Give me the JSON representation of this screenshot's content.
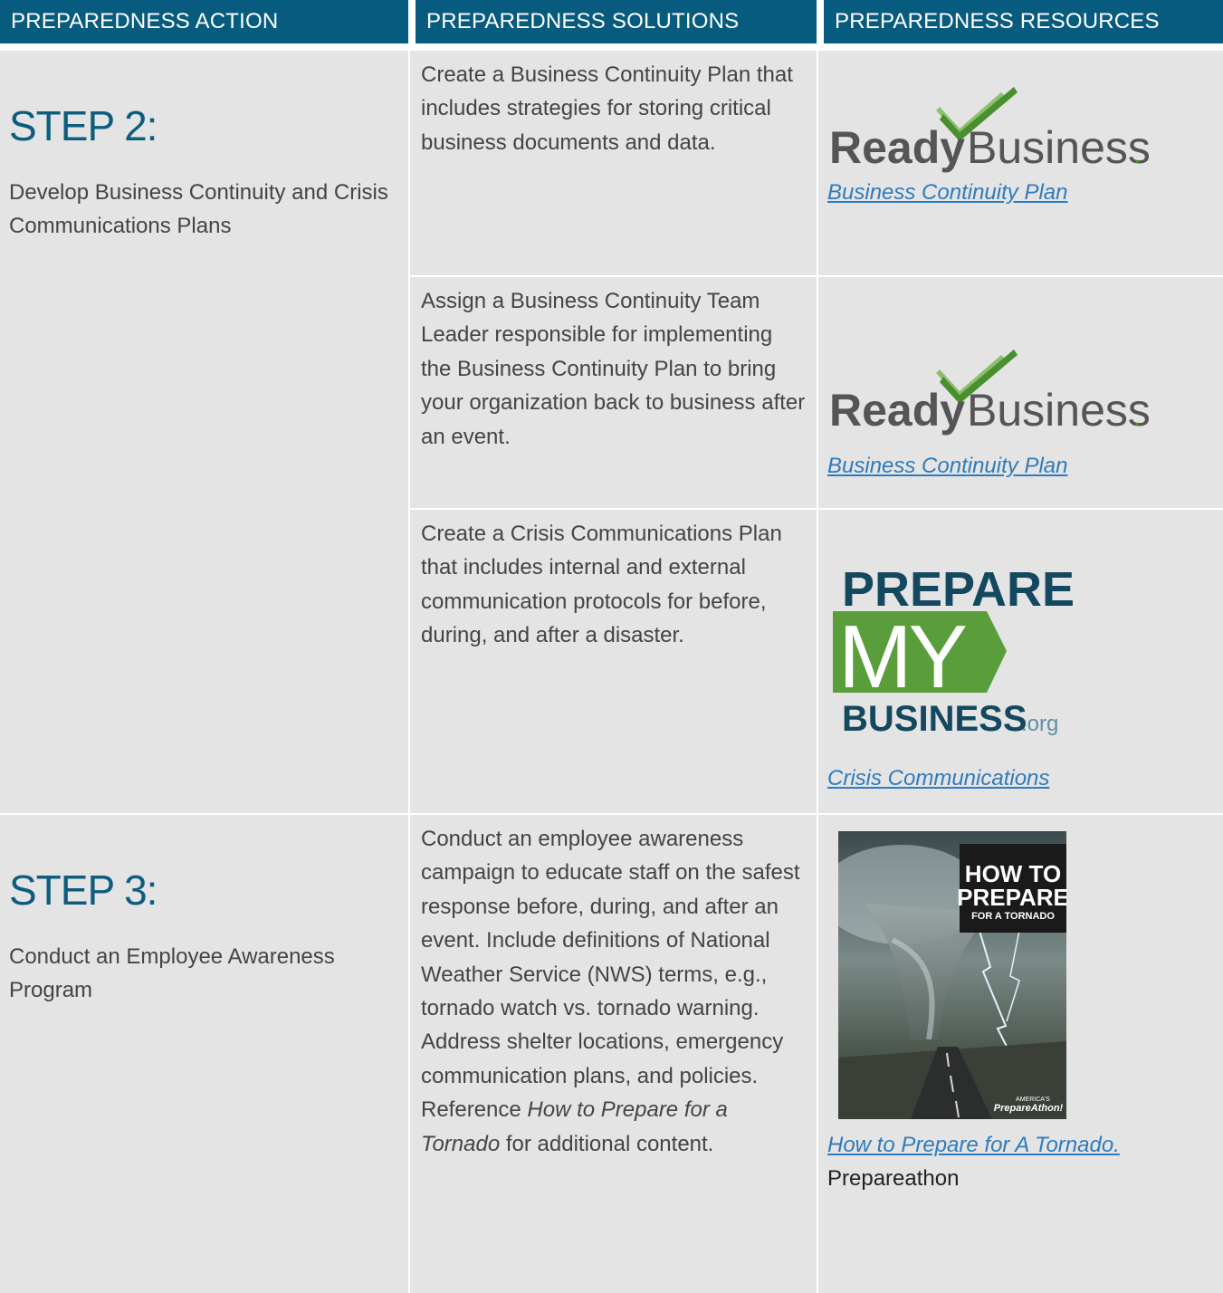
{
  "headers": {
    "action": "PREPAREDNESS ACTION",
    "solutions": "PREPAREDNESS SOLUTIONS",
    "resources": "PREPAREDNESS RESOURCES"
  },
  "step2": {
    "title": "STEP 2:",
    "description": "Develop Business Continuity and Crisis Communications Plans",
    "rows": [
      {
        "solution": "Create a Business Continuity Plan that includes strategies for storing critical business documents and data.",
        "logo": {
          "word1": "Ready",
          "word2": "Business",
          "dot": "."
        },
        "link": "Business Continuity Plan"
      },
      {
        "solution": "Assign a Business Continuity Team Leader responsible for implementing the Business Continuity Plan to bring your organization back to business after an event.",
        "logo": {
          "word1": "Ready",
          "word2": "Business",
          "dot": "."
        },
        "link": "Business Continuity Plan"
      },
      {
        "solution": "Create a Crisis Communications Plan that includes internal and external communication protocols for before, during, and after a disaster.",
        "logo": {
          "line1": "PREPARE",
          "line2": "MY",
          "line3": "BUSINESS",
          "suffix": ".org"
        },
        "link": "Crisis Communications"
      }
    ]
  },
  "step3": {
    "title": "STEP 3:",
    "description": "Conduct an Employee Awareness Program",
    "solution_before": "Conduct an employee awareness campaign to educate staff on the safest response before, during, and after an event. Include definitions of National Weather Service (NWS) terms, e.g., tornado watch vs. tornado warning. Address shelter locations, emergency communication plans, and policies. Reference ",
    "solution_italic": "How to Prepare for a Tornado",
    "solution_after": " for additional content.",
    "cover": {
      "line1": "HOW TO",
      "line2": "PREPARE",
      "line3": "FOR A TORNADO",
      "brand1": "AMERICA'S",
      "brand2": "PrepareAthon!"
    },
    "link": "How to Prepare for A Tornado.",
    "source": "Prepareathon"
  },
  "colors": {
    "header": "#075b7e",
    "cell": "#e5e4e4",
    "step": "#0d5d7f",
    "link": "#2e7bbd",
    "check_dark": "#4a8f2f",
    "check_light": "#8cc06a",
    "pmb_blue": "#14485e",
    "pmb_green": "#5a9e3c"
  }
}
